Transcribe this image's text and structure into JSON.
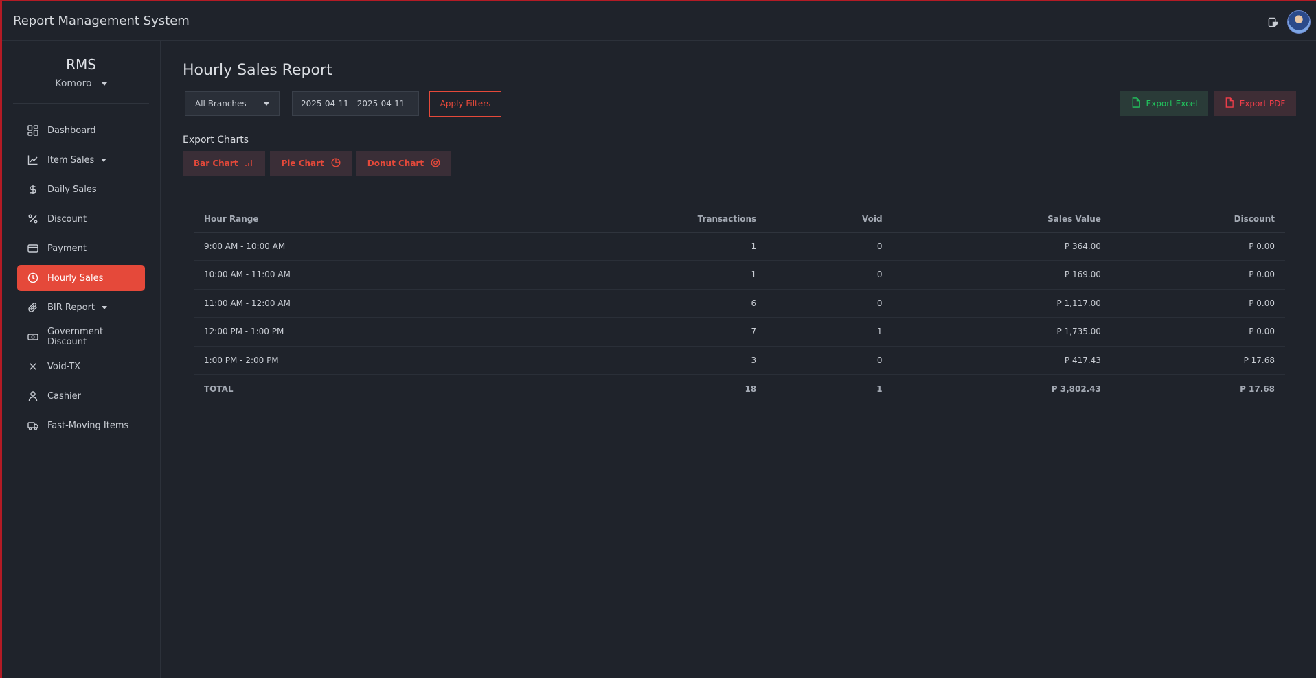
{
  "app": {
    "title": "Report Management System"
  },
  "header": {
    "theme_icon": "theme-toggle-icon",
    "avatar": "user-avatar"
  },
  "sidebar": {
    "brand": "RMS",
    "store": "Komoro",
    "items": [
      {
        "label": "Dashboard",
        "icon": "dashboard-icon"
      },
      {
        "label": "Item Sales",
        "icon": "chart-line-icon",
        "has_submenu": true
      },
      {
        "label": "Daily Sales",
        "icon": "dollar-icon"
      },
      {
        "label": "Discount",
        "icon": "percent-icon"
      },
      {
        "label": "Payment",
        "icon": "credit-card-icon"
      },
      {
        "label": "Hourly Sales",
        "icon": "clock-icon",
        "active": true
      },
      {
        "label": "BIR Report",
        "icon": "paperclip-icon",
        "has_submenu": true
      },
      {
        "label": "Government Discount",
        "icon": "banknote-icon"
      },
      {
        "label": "Void-TX",
        "icon": "x-icon"
      },
      {
        "label": "Cashier",
        "icon": "user-icon"
      },
      {
        "label": "Fast-Moving Items",
        "icon": "truck-icon"
      }
    ]
  },
  "main": {
    "title": "Hourly Sales Report",
    "filters": {
      "branch": "All Branches",
      "date_range": "2025-04-11 - 2025-04-11",
      "apply_label": "Apply Filters"
    },
    "export": {
      "excel_label": "Export Excel",
      "pdf_label": "Export PDF"
    },
    "export_charts": {
      "title": "Export Charts",
      "buttons": [
        {
          "label": "Bar Chart",
          "icon": "bar-chart-icon"
        },
        {
          "label": "Pie Chart",
          "icon": "pie-chart-icon"
        },
        {
          "label": "Donut Chart",
          "icon": "donut-chart-icon"
        }
      ]
    },
    "table": {
      "headers": [
        "Hour Range",
        "Transactions",
        "Void",
        "Sales Value",
        "Discount"
      ],
      "rows": [
        [
          "9:00 AM - 10:00 AM",
          "1",
          "0",
          "P 364.00",
          "P 0.00"
        ],
        [
          "10:00 AM - 11:00 AM",
          "1",
          "0",
          "P 169.00",
          "P 0.00"
        ],
        [
          "11:00 AM - 12:00 AM",
          "6",
          "0",
          "P 1,117.00",
          "P 0.00"
        ],
        [
          "12:00 PM - 1:00 PM",
          "7",
          "1",
          "P 1,735.00",
          "P 0.00"
        ],
        [
          "1:00 PM - 2:00 PM",
          "3",
          "0",
          "P 417.43",
          "P 17.68"
        ]
      ],
      "total": [
        "TOTAL",
        "18",
        "1",
        "P 3,802.43",
        "P 17.68"
      ]
    }
  },
  "colors": {
    "accent": "#e5493a",
    "background": "#1f232b",
    "excel": "#22c55e",
    "pdf": "#f03e4a",
    "frame": "#b31b25"
  }
}
